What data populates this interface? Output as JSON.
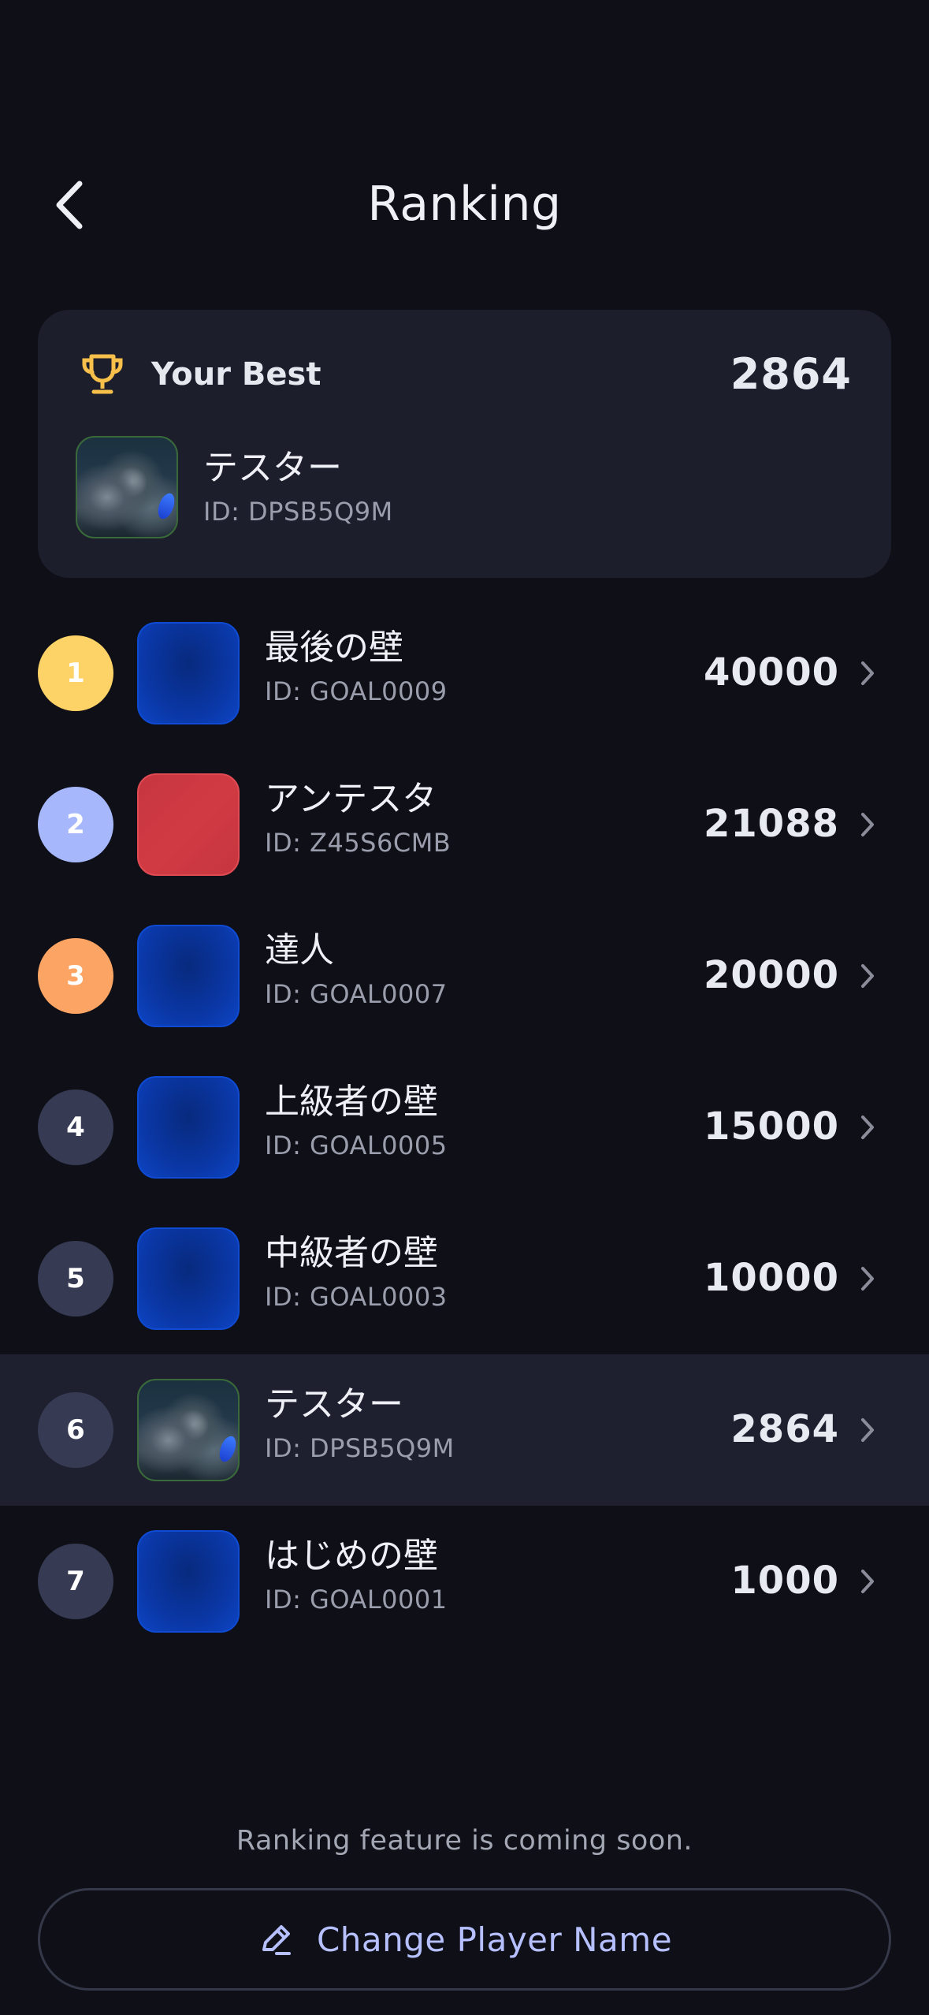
{
  "header": {
    "title": "Ranking",
    "back_icon": "chevron-left-icon"
  },
  "best": {
    "label": "Your Best",
    "score": "2864",
    "icon": "trophy-icon",
    "icon_color": "#f7c04a",
    "player": {
      "name": "テスター",
      "id": "ID: DPSB5Q9M",
      "avatar": "photo"
    }
  },
  "ranking": [
    {
      "rank": "1",
      "name": "最後の壁",
      "id": "ID: GOAL0009",
      "score": "40000",
      "avatar": "blue",
      "badge_color": "#fdd266"
    },
    {
      "rank": "2",
      "name": "アンテスタ",
      "id": "ID: Z45S6CMB",
      "score": "21088",
      "avatar": "red",
      "badge_color": "#a6b8fb"
    },
    {
      "rank": "3",
      "name": "達人",
      "id": "ID: GOAL0007",
      "score": "20000",
      "avatar": "blue",
      "badge_color": "#fca463"
    },
    {
      "rank": "4",
      "name": "上級者の壁",
      "id": "ID: GOAL0005",
      "score": "15000",
      "avatar": "blue",
      "badge_color": "#363a52"
    },
    {
      "rank": "5",
      "name": "中級者の壁",
      "id": "ID: GOAL0003",
      "score": "10000",
      "avatar": "blue",
      "badge_color": "#363a52"
    },
    {
      "rank": "6",
      "name": "テスター",
      "id": "ID: DPSB5Q9M",
      "score": "2864",
      "avatar": "photo",
      "badge_color": "#363a52",
      "highlighted": true
    },
    {
      "rank": "7",
      "name": "はじめの壁",
      "id": "ID: GOAL0001",
      "score": "1000",
      "avatar": "blue",
      "badge_color": "#363a52"
    }
  ],
  "footer": {
    "notice": "Ranking feature is coming soon.",
    "change_name_label": "Change Player Name",
    "change_name_icon": "pencil-icon",
    "accent": "#b7c0ff"
  },
  "colors": {
    "background": "#0e0f17",
    "card": "#1c1e2b",
    "highlight_row": "#1e2030"
  }
}
